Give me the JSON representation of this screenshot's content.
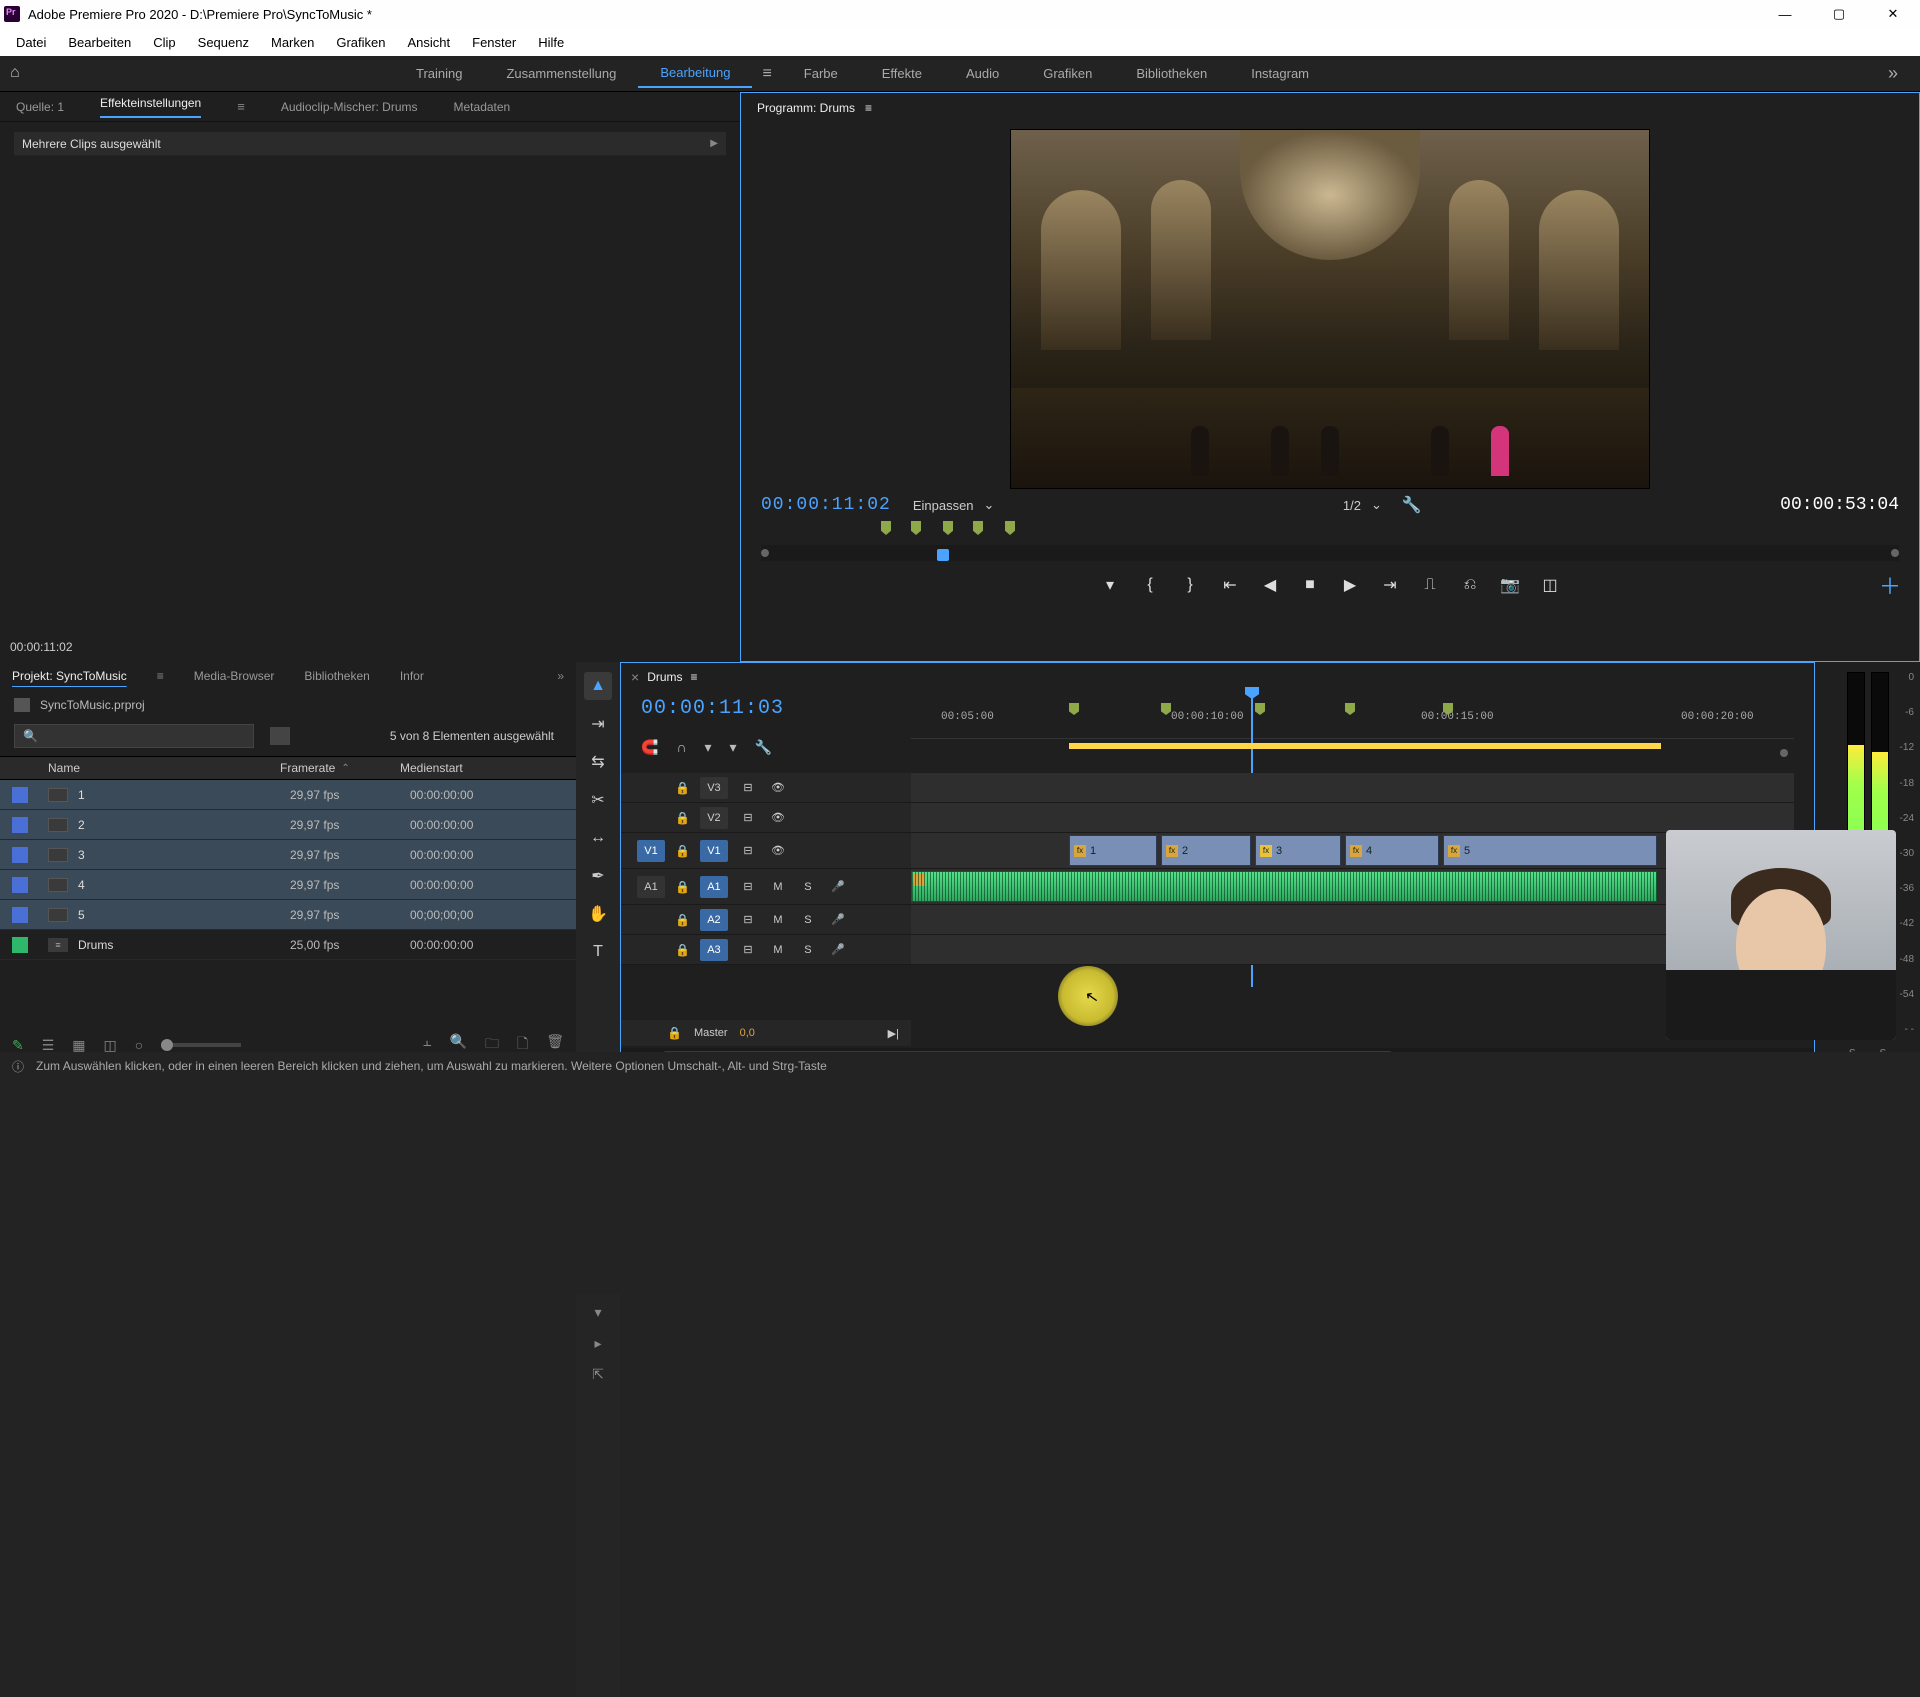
{
  "titlebar": {
    "text": "Adobe Premiere Pro 2020 - D:\\Premiere Pro\\SyncToMusic *"
  },
  "menu": [
    "Datei",
    "Bearbeiten",
    "Clip",
    "Sequenz",
    "Marken",
    "Grafiken",
    "Ansicht",
    "Fenster",
    "Hilfe"
  ],
  "workspaces": {
    "items": [
      "Training",
      "Zusammenstellung",
      "Bearbeitung",
      "Farbe",
      "Effekte",
      "Audio",
      "Grafiken",
      "Bibliotheken",
      "Instagram"
    ],
    "activeIndex": 2
  },
  "sourceTabs": {
    "source": "Quelle: 1",
    "fx": "Effekteinstellungen",
    "mixer": "Audioclip-Mischer: Drums",
    "meta": "Metadaten"
  },
  "effectControls": {
    "heading": "Mehrere Clips ausgewählt",
    "bottomTc": "00:00:11:02"
  },
  "program": {
    "title": "Programm: Drums",
    "leftTc": "00:00:11:02",
    "rightTc": "00:00:53:04",
    "fit": "Einpassen",
    "res": "1/2"
  },
  "project": {
    "tabs": {
      "project": "Projekt: SyncToMusic",
      "media": "Media-Browser",
      "libs": "Bibliotheken",
      "info": "Infor"
    },
    "file": "SyncToMusic.prproj",
    "count": "5 von 8 Elementen ausgewählt",
    "columns": {
      "name": "Name",
      "fr": "Framerate",
      "ms": "Medienstart"
    },
    "rows": [
      {
        "name": "1",
        "fr": "29,97 fps",
        "ms": "00:00:00:00",
        "sel": true,
        "type": "clip"
      },
      {
        "name": "2",
        "fr": "29,97 fps",
        "ms": "00:00:00:00",
        "sel": true,
        "type": "clip"
      },
      {
        "name": "3",
        "fr": "29,97 fps",
        "ms": "00:00:00:00",
        "sel": true,
        "type": "clip"
      },
      {
        "name": "4",
        "fr": "29,97 fps",
        "ms": "00:00:00:00",
        "sel": true,
        "type": "clip"
      },
      {
        "name": "5",
        "fr": "29,97 fps",
        "ms": "00;00;00;00",
        "sel": true,
        "type": "clip"
      },
      {
        "name": "Drums",
        "fr": "25,00 fps",
        "ms": "00:00:00:00",
        "sel": false,
        "type": "seq"
      }
    ]
  },
  "timeline": {
    "name": "Drums",
    "tc": "00:00:11:03",
    "ruler": [
      "00:05:00",
      "00:00:10:00",
      "00:00:15:00",
      "00:00:20:00"
    ],
    "tracks": {
      "v": [
        "V3",
        "V2",
        "V1"
      ],
      "a": [
        "A1",
        "A2",
        "A3"
      ],
      "master": "Master",
      "masterVal": "0,0"
    },
    "clips": [
      {
        "n": "1"
      },
      {
        "n": "2"
      },
      {
        "n": "3"
      },
      {
        "n": "4"
      },
      {
        "n": "5"
      }
    ],
    "srcV": "V1",
    "srcA": "A1"
  },
  "meters": {
    "scale": [
      "0",
      "-6",
      "-12",
      "-18",
      "-24",
      "-30",
      "-36",
      "-42",
      "-48",
      "-54",
      "- -"
    ],
    "solo": "S"
  },
  "status": "Zum Auswählen klicken, oder in einen leeren Bereich klicken und ziehen, um Auswahl zu markieren. Weitere Optionen Umschalt-, Alt- und Strg-Taste"
}
